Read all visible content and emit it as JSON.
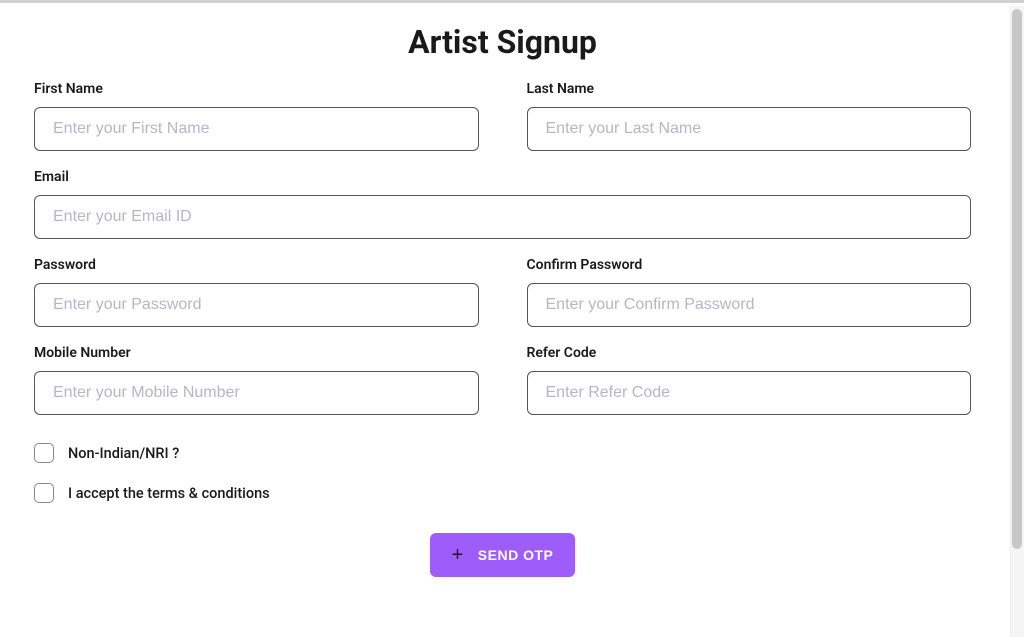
{
  "header": {
    "title": "Artist Signup"
  },
  "form": {
    "first_name": {
      "label": "First Name",
      "placeholder": "Enter your First Name",
      "value": ""
    },
    "last_name": {
      "label": "Last Name",
      "placeholder": "Enter your Last Name",
      "value": ""
    },
    "email": {
      "label": "Email",
      "placeholder": "Enter your Email ID",
      "value": ""
    },
    "password": {
      "label": "Password",
      "placeholder": "Enter your Password",
      "value": ""
    },
    "confirm_password": {
      "label": "Confirm Password",
      "placeholder": "Enter your Confirm Password",
      "value": ""
    },
    "mobile_number": {
      "label": "Mobile Number",
      "placeholder": "Enter your Mobile Number",
      "value": ""
    },
    "refer_code": {
      "label": "Refer Code",
      "placeholder": "Enter Refer Code",
      "value": ""
    }
  },
  "checkboxes": {
    "non_indian": {
      "label": "Non-Indian/NRI ?",
      "checked": false
    },
    "terms": {
      "label": "I accept the terms & conditions",
      "checked": false
    }
  },
  "actions": {
    "send_otp": "SEND OTP"
  }
}
